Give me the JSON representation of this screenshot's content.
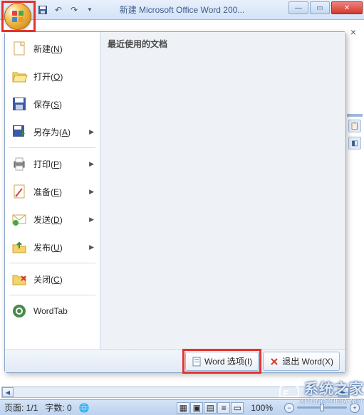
{
  "title": "新建 Microsoft Office Word 200...",
  "menu": {
    "recent_header": "最近使用的文档",
    "items": [
      {
        "label": "新建",
        "key": "N",
        "arrow": false
      },
      {
        "label": "打开",
        "key": "O",
        "arrow": false
      },
      {
        "label": "保存",
        "key": "S",
        "arrow": false
      },
      {
        "label": "另存为",
        "key": "A",
        "arrow": true
      },
      {
        "label": "打印",
        "key": "P",
        "arrow": true
      },
      {
        "label": "准备",
        "key": "E",
        "arrow": true
      },
      {
        "label": "发送",
        "key": "D",
        "arrow": true
      },
      {
        "label": "发布",
        "key": "U",
        "arrow": true
      },
      {
        "label": "关闭",
        "key": "C",
        "arrow": false
      }
    ],
    "wordtab": "WordTab",
    "footer": {
      "options": "Word 选项",
      "options_key": "I",
      "exit": "退出 Word",
      "exit_key": "X"
    }
  },
  "status": {
    "page": "页面: 1/1",
    "words": "字数: 0",
    "zoom": "100%"
  },
  "watermark": {
    "text": "系统之家",
    "url": "XITONGZHIJIA.NET"
  }
}
